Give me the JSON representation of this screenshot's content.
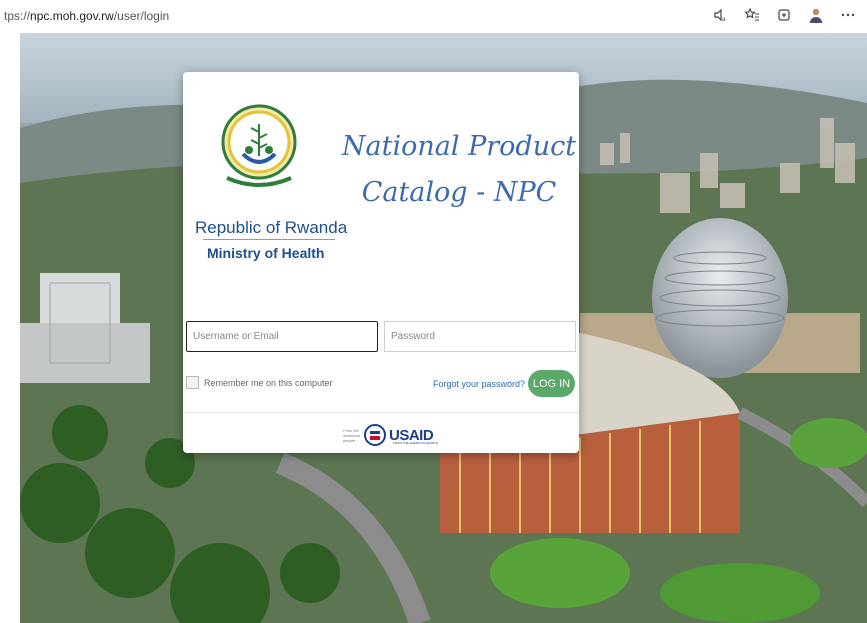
{
  "browser": {
    "url_prefix": "tps://",
    "url_host": "npc.moh.gov.rw",
    "url_path": "/user/login",
    "toolbar_icons": [
      "read-aloud-icon",
      "favorites-icon",
      "collections-icon",
      "profile-avatar-icon",
      "more-icon"
    ]
  },
  "branding": {
    "republic": "Republic of Rwanda",
    "ministry": "Ministry of Health",
    "title_line1": "National Product",
    "title_line2": "Catalog - NPC"
  },
  "form": {
    "username_placeholder": "Username or Email",
    "password_placeholder": "Password",
    "remember_label": "Remember me on this computer",
    "forgot_link": "Forgot your password?",
    "login_button": "LOG IN"
  },
  "footer": {
    "logo_text": "USAID",
    "logo_tagline": "FROM THE AMERICAN PEOPLE",
    "logo_pretext": "From the American people"
  },
  "colors": {
    "brand_blue": "#1f4e8c",
    "title_blue": "#3b6ab0",
    "login_green": "#5aa86a",
    "usaid_blue": "#1d3f84"
  }
}
